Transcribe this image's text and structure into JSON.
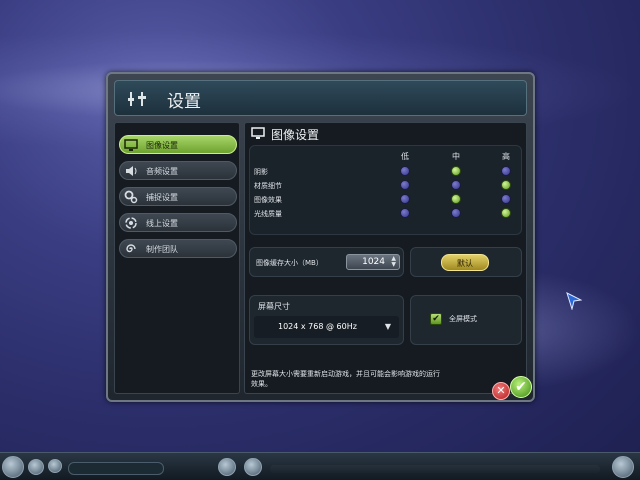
{
  "window": {
    "title": "设置"
  },
  "sidebar": {
    "items": [
      {
        "label": "图像设置",
        "icon": "monitor-icon",
        "active": true
      },
      {
        "label": "音频设置",
        "icon": "speaker-icon",
        "active": false
      },
      {
        "label": "捕捉设置",
        "icon": "gears-icon",
        "active": false
      },
      {
        "label": "线上设置",
        "icon": "globe-arrows-icon",
        "active": false
      },
      {
        "label": "制作团队",
        "icon": "spiral-icon",
        "active": false
      }
    ]
  },
  "graphics": {
    "heading": "图像设置",
    "columns": [
      "低",
      "中",
      "高"
    ],
    "rows": [
      {
        "label": "阴影",
        "selected": "中"
      },
      {
        "label": "材质细节",
        "selected": "高"
      },
      {
        "label": "图像效果",
        "selected": "中"
      },
      {
        "label": "光线质量",
        "selected": "高"
      }
    ],
    "cache_label": "图像缓存大小（MB）",
    "cache_value": "1024",
    "default_button": "默认",
    "screen_label": "屏幕尺寸",
    "resolution": "1024 x 768 @ 60Hz",
    "fullscreen_label": "全屏模式",
    "fullscreen_checked": true,
    "note": "更改屏幕大小需要重新启动游戏，并且可能会影响游戏的运行效果。"
  },
  "colors": {
    "active_green": "#8cc04a",
    "radio_off": "#4a4aa8",
    "radio_on": "#9ad04c",
    "default_gold": "#c8b040",
    "cancel_red": "#d23a3a",
    "ok_green": "#5aa822"
  }
}
